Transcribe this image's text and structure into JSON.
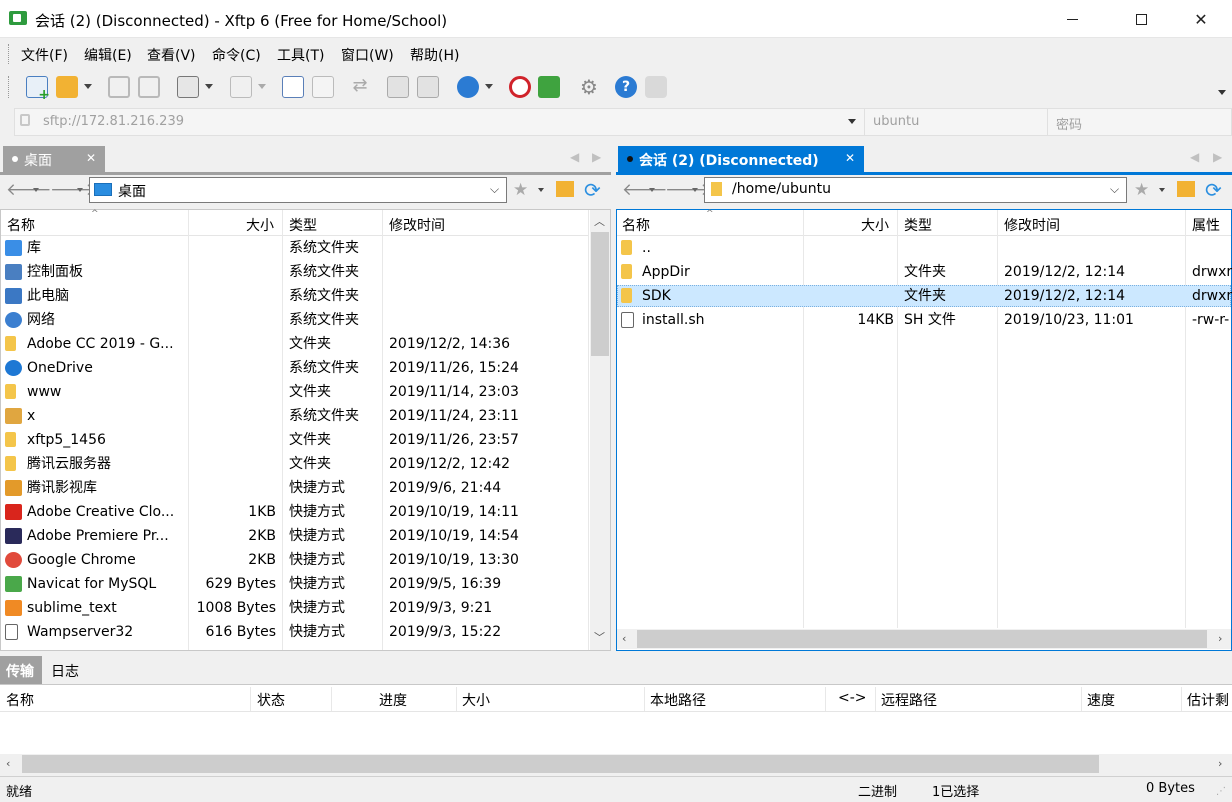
{
  "window": {
    "title": "会话 (2) (Disconnected) - Xftp 6 (Free for Home/School)"
  },
  "menu": [
    "文件(F)",
    "编辑(E)",
    "查看(V)",
    "命令(C)",
    "工具(T)",
    "窗口(W)",
    "帮助(H)"
  ],
  "address": {
    "url": "sftp://172.81.216.239",
    "user": "ubuntu",
    "password_placeholder": "密码"
  },
  "left": {
    "tab": "桌面",
    "path": "桌面",
    "columns": [
      "名称",
      "大小",
      "类型",
      "修改时间"
    ],
    "rows": [
      {
        "name": "库",
        "size": "",
        "type": "系统文件夹",
        "time": "",
        "icon": "library-icon",
        "color": "#3a8ee6"
      },
      {
        "name": "控制面板",
        "size": "",
        "type": "系统文件夹",
        "time": "",
        "icon": "control-panel-icon",
        "color": "#4a7fc1"
      },
      {
        "name": "此电脑",
        "size": "",
        "type": "系统文件夹",
        "time": "",
        "icon": "computer-icon",
        "color": "#3b78c4"
      },
      {
        "name": "网络",
        "size": "",
        "type": "系统文件夹",
        "time": "",
        "icon": "network-icon",
        "color": "#3b7fd0"
      },
      {
        "name": "Adobe CC 2019 - G...",
        "size": "",
        "type": "文件夹",
        "time": "2019/12/2, 14:36",
        "icon": "folder-icon",
        "color": "#f4c54a"
      },
      {
        "name": "OneDrive",
        "size": "",
        "type": "系统文件夹",
        "time": "2019/11/26, 15:24",
        "icon": "onedrive-icon",
        "color": "#1e78d4"
      },
      {
        "name": "www",
        "size": "",
        "type": "文件夹",
        "time": "2019/11/14, 23:03",
        "icon": "folder-icon",
        "color": "#f4c54a"
      },
      {
        "name": "x",
        "size": "",
        "type": "系统文件夹",
        "time": "2019/11/24, 23:11",
        "icon": "user-folder-icon",
        "color": "#e0a640"
      },
      {
        "name": "xftp5_1456",
        "size": "",
        "type": "文件夹",
        "time": "2019/11/26, 23:57",
        "icon": "folder-icon",
        "color": "#f4c54a"
      },
      {
        "name": "腾讯云服务器",
        "size": "",
        "type": "文件夹",
        "time": "2019/12/2, 12:42",
        "icon": "folder-icon",
        "color": "#f4c54a"
      },
      {
        "name": "腾讯影视库",
        "size": "",
        "type": "快捷方式",
        "time": "2019/9/6, 21:44",
        "icon": "shortcut-icon",
        "color": "#e39a2a"
      },
      {
        "name": "Adobe Creative Clo...",
        "size": "1KB",
        "type": "快捷方式",
        "time": "2019/10/19, 14:11",
        "icon": "adobe-cc-icon",
        "color": "#d9251c"
      },
      {
        "name": "Adobe Premiere Pr...",
        "size": "2KB",
        "type": "快捷方式",
        "time": "2019/10/19, 14:54",
        "icon": "premiere-icon",
        "color": "#2a2a5a"
      },
      {
        "name": "Google Chrome",
        "size": "2KB",
        "type": "快捷方式",
        "time": "2019/10/19, 13:30",
        "icon": "chrome-icon",
        "color": "#e14a3b"
      },
      {
        "name": "Navicat for MySQL",
        "size": "629 Bytes",
        "type": "快捷方式",
        "time": "2019/9/5, 16:39",
        "icon": "navicat-icon",
        "color": "#4aa84a"
      },
      {
        "name": "sublime_text",
        "size": "1008 Bytes",
        "type": "快捷方式",
        "time": "2019/9/3, 9:21",
        "icon": "sublime-icon",
        "color": "#f08a24"
      },
      {
        "name": "Wampserver32",
        "size": "616 Bytes",
        "type": "快捷方式",
        "time": "2019/9/3, 15:22",
        "icon": "file-icon",
        "color": "#ffffff"
      }
    ]
  },
  "right": {
    "tab": "会话 (2) (Disconnected)",
    "path": "/home/ubuntu",
    "columns": [
      "名称",
      "大小",
      "类型",
      "修改时间",
      "属性"
    ],
    "rows": [
      {
        "name": "..",
        "size": "",
        "type": "",
        "time": "",
        "attr": "",
        "icon": "folder-icon",
        "color": "#f4c54a"
      },
      {
        "name": "AppDir",
        "size": "",
        "type": "文件夹",
        "time": "2019/12/2, 12:14",
        "attr": "drwxr",
        "icon": "folder-icon",
        "color": "#f4c54a"
      },
      {
        "name": "SDK",
        "size": "",
        "type": "文件夹",
        "time": "2019/12/2, 12:14",
        "attr": "drwxr",
        "icon": "folder-icon",
        "color": "#f4c54a"
      },
      {
        "name": "install.sh",
        "size": "14KB",
        "type": "SH 文件",
        "time": "2019/10/23, 11:01",
        "attr": "-rw-r-",
        "icon": "file-icon",
        "color": "#ffffff"
      }
    ],
    "selected_index": 2
  },
  "bottom": {
    "tabs": [
      "传输",
      "日志"
    ],
    "columns": [
      "名称",
      "状态",
      "进度",
      "大小",
      "本地路径",
      "<->",
      "远程路径",
      "速度",
      "估计剩"
    ]
  },
  "statusbar": {
    "left": "就绪",
    "mode": "二进制",
    "selected": "1已选择",
    "bytes": "0 Bytes"
  },
  "colors": {
    "accent": "#0078d7",
    "selection": "#cce8ff"
  }
}
